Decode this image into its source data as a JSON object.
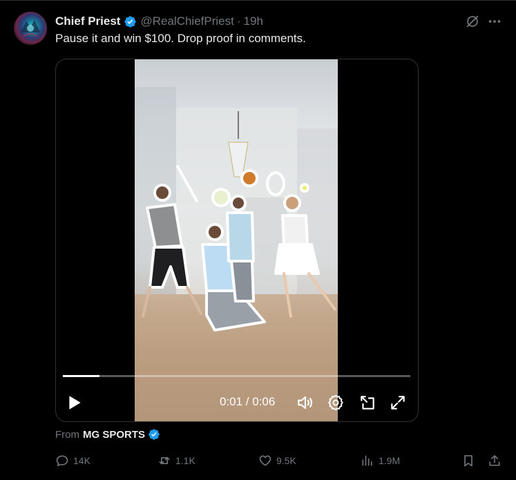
{
  "tweet": {
    "author_name": "Chief Priest",
    "handle": "@RealChiefPriest",
    "separator": "·",
    "time": "19h",
    "text": "Pause it and win $100. Drop proof in comments."
  },
  "video": {
    "elapsed": "0:01",
    "duration": "0:06",
    "time_readout": "0:01 / 0:06",
    "progress": 0.105
  },
  "source": {
    "prefix": "From",
    "name": "MG SPORTS"
  },
  "metrics": {
    "replies": "14K",
    "reposts": "1.1K",
    "likes": "9.5K",
    "views": "1.9M"
  },
  "colors": {
    "background": "#000000",
    "text_primary": "#e7e9ea",
    "text_secondary": "#71767b",
    "verified_blue": "#1d9bf0",
    "border": "#2f3336"
  },
  "icons": {
    "verified": "verified-badge-icon",
    "grok": "grok-icon",
    "more": "more-icon",
    "play": "play-icon",
    "volume": "volume-icon",
    "settings": "gear-icon",
    "pip": "picture-in-picture-icon",
    "fullscreen": "fullscreen-icon",
    "reply": "reply-icon",
    "repost": "repost-icon",
    "like": "heart-icon",
    "views": "views-icon",
    "bookmark": "bookmark-icon",
    "share": "share-icon"
  }
}
